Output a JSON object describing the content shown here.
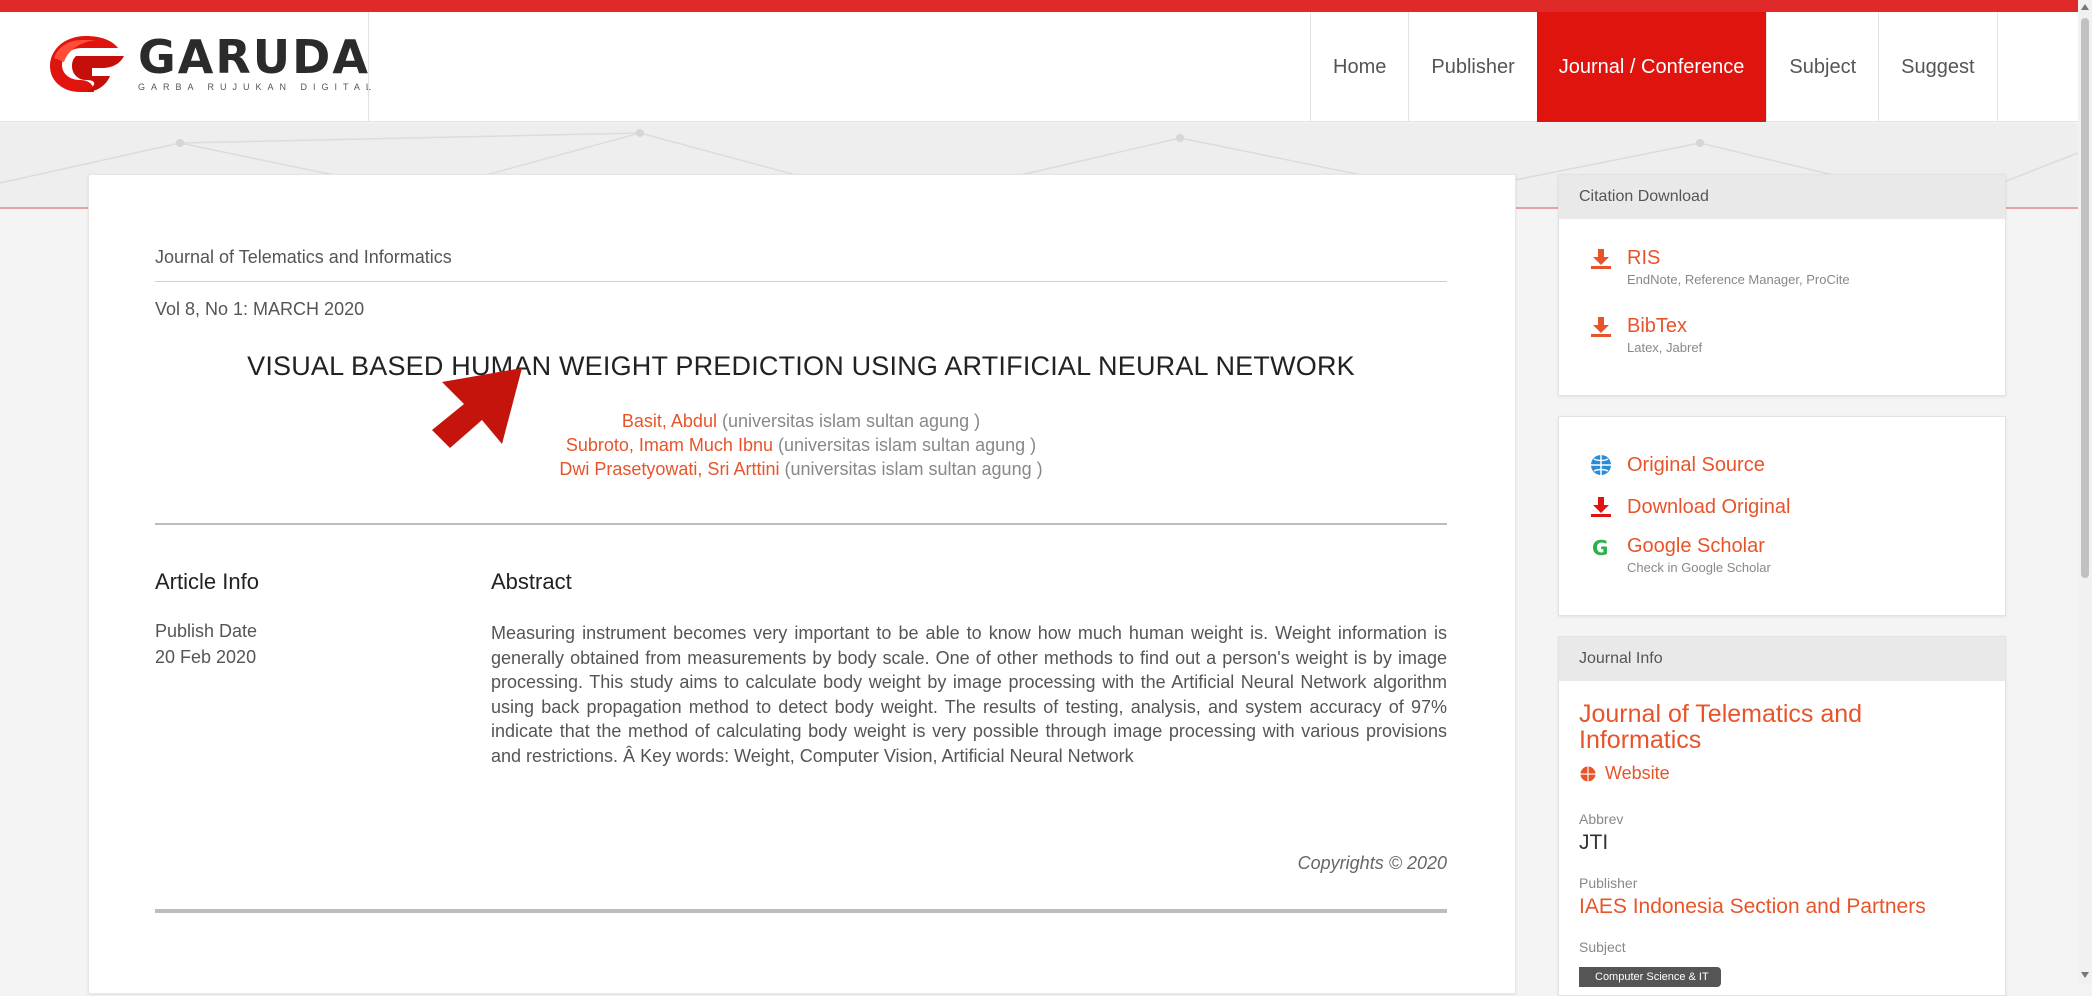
{
  "brand": {
    "name": "GARUDA",
    "tagline": "GARBA RUJUKAN DIGITAL",
    "color": "#e0140f"
  },
  "nav": {
    "items": [
      "Home",
      "Publisher",
      "Journal / Conference",
      "Subject",
      "Suggest"
    ],
    "active": "Journal / Conference"
  },
  "article": {
    "journal": "Journal of Telematics and Informatics",
    "volume": "Vol 8, No 1: MARCH 2020",
    "title": "VISUAL BASED HUMAN WEIGHT PREDICTION USING ARTIFICIAL NEURAL NETWORK",
    "authors": [
      {
        "name": "Basit, Abdul",
        "affiliation": "(universitas islam sultan agung )"
      },
      {
        "name": "Subroto, Imam Much Ibnu",
        "affiliation": "(universitas islam sultan agung )"
      },
      {
        "name": "Dwi Prasetyowati, Sri Arttini",
        "affiliation": "(universitas islam sultan agung )"
      }
    ],
    "article_info_heading": "Article Info",
    "publish_date_label": "Publish Date",
    "publish_date": "20 Feb 2020",
    "abstract_heading": "Abstract",
    "abstract": "Measuring instrument becomes very important to be able to know how much human weight is. Weight information is generally obtained from measurements by body scale. One of other methods to find out a person's weight is by image processing. This study aims to calculate body weight by image processing with the Artificial Neural Network algorithm using back propagation method to detect body weight. The results of testing, analysis, and system accuracy of 97% indicate that the method of calculating body weight is very possible through image processing with various provisions and restrictions. Â  Key words: Weight, Computer Vision, Artificial Neural Network",
    "copyright": "Copyrights © 2020"
  },
  "citation": {
    "heading": "Citation Download",
    "ris_title": "RIS",
    "ris_sub": "EndNote, Reference Manager, ProCite",
    "bibtex_title": "BibTex",
    "bibtex_sub": "Latex, Jabref"
  },
  "links": {
    "original_source": "Original Source",
    "download_original": "Download Original",
    "google_scholar": "Google Scholar",
    "google_scholar_sub": "Check in Google Scholar"
  },
  "journal_info": {
    "heading": "Journal Info",
    "title": "Journal of Telematics and Informatics",
    "website": "Website",
    "abbrev_label": "Abbrev",
    "abbrev": "JTI",
    "publisher_label": "Publisher",
    "publisher": "IAES Indonesia Section and Partners",
    "subject_label": "Subject",
    "subject_tag": "Computer Science & IT"
  },
  "colors": {
    "accent": "#e8542a",
    "nav_active": "#e0140f",
    "download_icon": "#e8542a",
    "source_icon": "#2a8bd6",
    "scholar_icon": "#2bb24c"
  }
}
